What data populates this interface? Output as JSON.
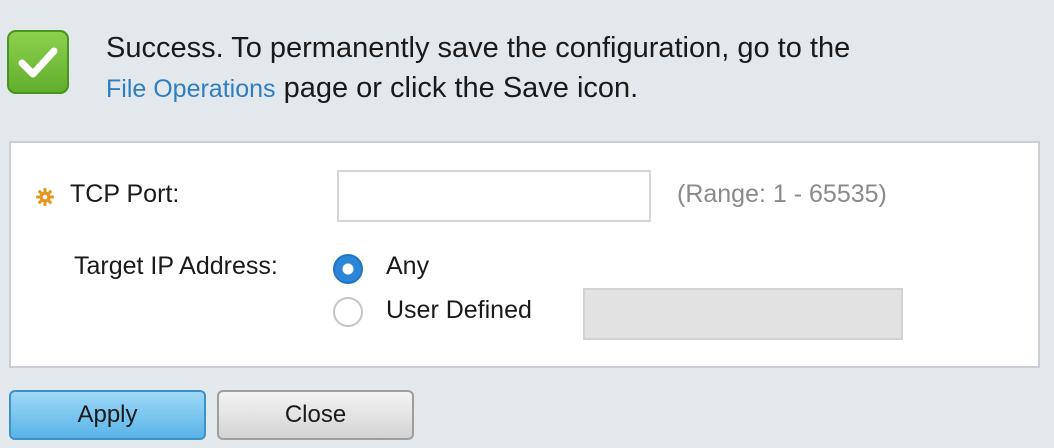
{
  "banner": {
    "icon": "check-icon",
    "text_line1": "Success. To permanently save the configuration, go to the",
    "link_text": "File Operations",
    "text_line2_suffix": " page or click the Save icon."
  },
  "form": {
    "required_icon": "required-gear-icon",
    "tcp_port_label": "TCP Port:",
    "tcp_port_value": "",
    "tcp_port_range_hint": "(Range: 1 - 65535)",
    "target_ip_label": "Target IP Address:",
    "options": [
      {
        "label": "Any",
        "selected": true
      },
      {
        "label": "User Defined",
        "selected": false
      }
    ],
    "user_defined_value": ""
  },
  "buttons": {
    "apply_label": "Apply",
    "close_label": "Close"
  },
  "colors": {
    "success_green": "#6dbd3a",
    "link_blue": "#2e7ec1",
    "radio_selected": "#2b86d6",
    "required_orange": "#e8961e",
    "apply_blue": "#58b4e8"
  }
}
